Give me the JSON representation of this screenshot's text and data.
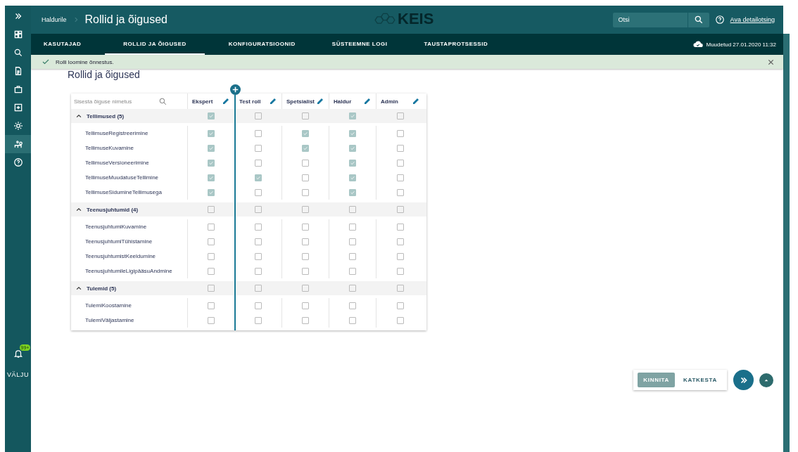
{
  "header": {
    "breadcrumb": "Haldurile",
    "title": "Rollid ja õigused",
    "logo": "KEIS",
    "search": {
      "placeholder": "Otsi"
    },
    "help_link": "Ava detailotsing"
  },
  "tabs": [
    {
      "label": "KASUTAJAD",
      "selected": false
    },
    {
      "label": "ROLLID JA ÕIGUSED",
      "selected": true
    },
    {
      "label": "KONFIGURATSIOONID",
      "selected": false
    },
    {
      "label": "SÜSTEEMNE LOGI",
      "selected": false
    },
    {
      "label": "TAUSTAPROTSESSID",
      "selected": false
    }
  ],
  "saved_status": "Muudetud 27.01.2020 11:32",
  "notification": {
    "text": "Rolli loomine õnnestus."
  },
  "sidebar": {
    "items": [
      {
        "kind": "expand",
        "selected": false
      },
      {
        "kind": "dashboard",
        "selected": false
      },
      {
        "kind": "search",
        "selected": false
      },
      {
        "kind": "document",
        "selected": false
      },
      {
        "kind": "briefcase",
        "selected": false
      },
      {
        "kind": "plus",
        "selected": false
      },
      {
        "kind": "settings",
        "selected": false
      },
      {
        "kind": "people",
        "selected": true
      },
      {
        "kind": "help",
        "selected": false
      }
    ],
    "badge": "99+",
    "logout": "VÄLJU"
  },
  "page_title": "Rollid ja õigused",
  "filter": {
    "placeholder": "Sisesta õiguse nimetus"
  },
  "roles": [
    "Ekspert",
    "Test roll",
    "Spetsialist",
    "Haldur",
    "Admin"
  ],
  "groups": [
    {
      "name": "Tellimused (5)",
      "expanded": true,
      "checks": [
        true,
        false,
        false,
        true,
        false
      ],
      "rows": [
        {
          "name": "TellimuseRegistreerimine",
          "checks": [
            true,
            false,
            true,
            true,
            false
          ]
        },
        {
          "name": "TellimuseKuvamine",
          "checks": [
            true,
            false,
            true,
            true,
            false
          ]
        },
        {
          "name": "TellimuseVersioneerimine",
          "checks": [
            true,
            false,
            false,
            true,
            false
          ]
        },
        {
          "name": "TellimuseMuudatuseTellimine",
          "checks": [
            true,
            true,
            false,
            true,
            false
          ]
        },
        {
          "name": "TellimuseSidumineTellimusega",
          "checks": [
            true,
            false,
            false,
            true,
            false
          ]
        }
      ]
    },
    {
      "name": "Teenusjuhtumid (4)",
      "expanded": true,
      "checks": [
        false,
        false,
        false,
        false,
        false
      ],
      "rows": [
        {
          "name": "TeenusjuhtumiKuvamine",
          "checks": [
            false,
            false,
            false,
            false,
            false
          ]
        },
        {
          "name": "TeenusjuhtumiTühistamine",
          "checks": [
            false,
            false,
            false,
            false,
            false
          ]
        },
        {
          "name": "TeenusjuhtumistKeeldumine",
          "checks": [
            false,
            false,
            false,
            false,
            false
          ]
        },
        {
          "name": "TeenusjuhtumileLigipääsuAndmine",
          "checks": [
            false,
            false,
            false,
            false,
            false
          ]
        }
      ]
    },
    {
      "name": "Tulemid (5)",
      "expanded": true,
      "checks": [
        false,
        false,
        false,
        false,
        false
      ],
      "rows": [
        {
          "name": "TulemiKoostamine",
          "checks": [
            false,
            false,
            false,
            false,
            false
          ]
        },
        {
          "name": "TulemiVäljastamine",
          "checks": [
            false,
            false,
            false,
            false,
            false
          ]
        }
      ]
    }
  ],
  "actions": [
    {
      "label": "KINNITA",
      "disabled": true
    },
    {
      "label": "KATKESTA",
      "disabled": false
    }
  ]
}
